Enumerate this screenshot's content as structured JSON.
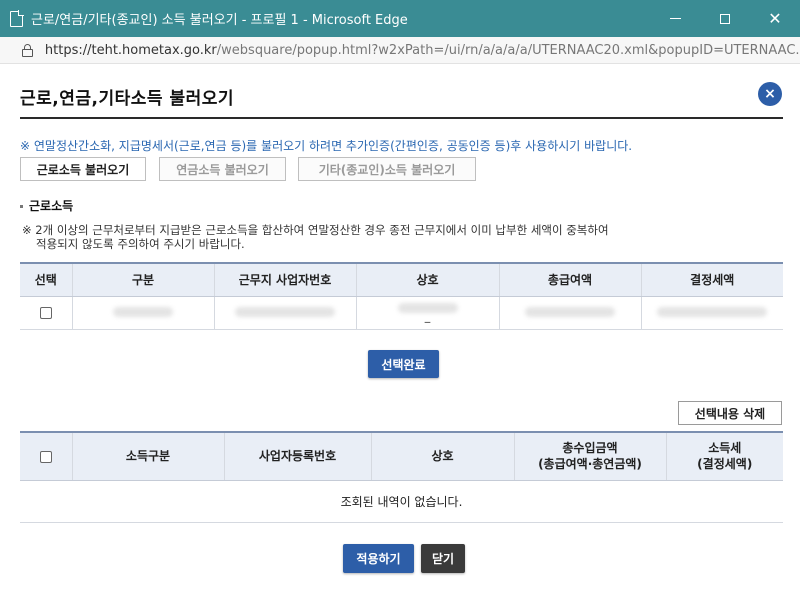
{
  "window": {
    "title": "근로/연금/기타(종교인) 소득 불러오기 - 프로필 1 - Microsoft Edge",
    "url_host": "https://teht.hometax.go.kr",
    "url_rest": "/websquare/popup.html?w2xPath=/ui/rn/a/a/a/a/UTERNAAC20.xml&popupID=UTERNAAC..."
  },
  "popup": {
    "title": "근로,연금,기타소득 불러오기",
    "close_label": "×",
    "notice": "※ 연말정산간소화, 지급명세서(근로,연금 등)를 불러오기 하려면 추가인증(간편인증, 공동인증 등)후 사용하시기 바랍니다."
  },
  "tabs": [
    {
      "label": "근로소득 불러오기",
      "enabled": true
    },
    {
      "label": "연금소득 불러오기",
      "enabled": false
    },
    {
      "label": "기타(종교인)소득 불러오기",
      "enabled": false
    }
  ],
  "section": {
    "title": "근로소득",
    "warning_line1": "※ 2개 이상의 근무처로부터 지급받은 근로소득을 합산하여 연말정산한 경우 종전 근무지에서 이미 납부한 세액이 중복하여",
    "warning_line2": "적용되지 않도록 주의하여 주시기 바랍니다."
  },
  "income_table": {
    "headers": [
      "선택",
      "구분",
      "근무지 사업자번호",
      "상호",
      "총급여액",
      "결정세액"
    ],
    "rows": [
      {
        "checked": false,
        "type": "",
        "biz_no": "",
        "name": "_",
        "total_pay": "",
        "tax": ""
      }
    ]
  },
  "buttons": {
    "select_done": "선택완료",
    "delete_selection": "선택내용 삭제",
    "apply": "적용하기",
    "close": "닫기"
  },
  "result_table": {
    "headers": [
      "",
      "소득구분",
      "사업자등록번호",
      "상호",
      "총수입금액\n(총급여액·총연금액)",
      "소득세\n(결정세액)"
    ],
    "header_income_line1": "총수입금액",
    "header_income_line2": "(총급여액·총연금액)",
    "header_tax_line1": "소득세",
    "header_tax_line2": "(결정세액)",
    "empty_message": "조회된 내역이 없습니다."
  }
}
